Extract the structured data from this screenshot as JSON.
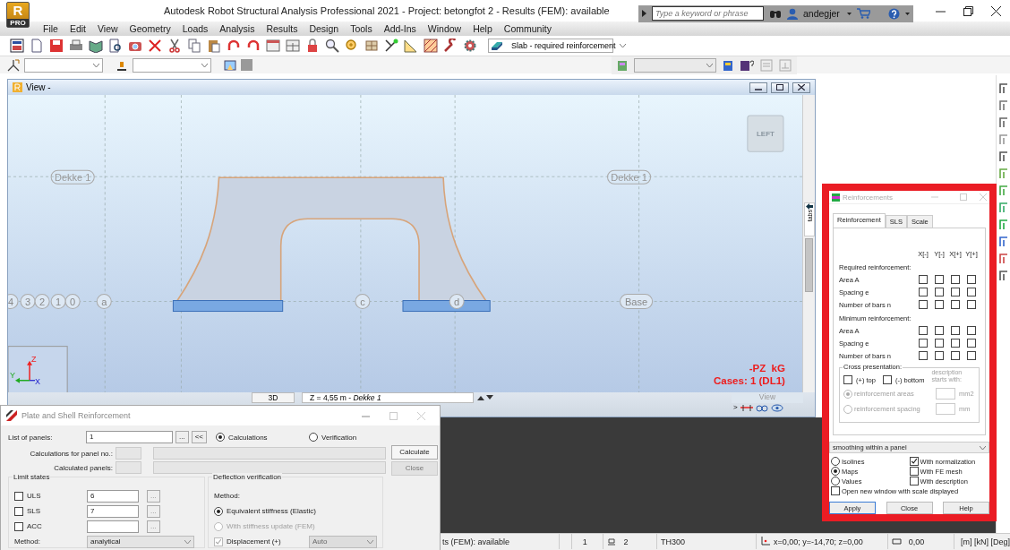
{
  "window": {
    "logo_letter": "R",
    "logo_edition": "PRO",
    "title": "Autodesk Robot Structural Analysis Professional 2021 - Project: betongfot 2 - Results (FEM): available"
  },
  "search": {
    "placeholder": "Type a keyword or phrase"
  },
  "user": "andegjer",
  "menu": [
    "File",
    "Edit",
    "View",
    "Geometry",
    "Loads",
    "Analysis",
    "Results",
    "Design",
    "Tools",
    "Add-Ins",
    "Window",
    "Help",
    "Community"
  ],
  "toolbar": {
    "result_view": "Slab - required reinforcement"
  },
  "view": {
    "title": "View -",
    "cube_label": "LEFT",
    "level_labels": [
      "Dekke 1",
      "Dekke 1"
    ],
    "axis_labels": [
      "4",
      "3",
      "2",
      "1",
      "0",
      "a",
      "c",
      "d",
      "Base"
    ],
    "triad_labels": [
      "Z",
      "Y",
      "X"
    ],
    "result_label": "-PZ  kG",
    "cases": "Cases: 1 (DL1)",
    "mode_button": "3D",
    "level_field": "Z = 4,55 m - *Dekke 1*",
    "view_tab": "View",
    "side_tab": "tabs",
    "nav_arrow": ">"
  },
  "reinforcements": {
    "title": "Reinforcements",
    "tabs": [
      {
        "label": "Reinforcement",
        "selected": true
      },
      {
        "label": "SLS",
        "selected": false
      },
      {
        "label": "Scale",
        "selected": false
      }
    ],
    "columns": [
      "X[-]",
      "Y[-]",
      "X[+]",
      "Y[+]"
    ],
    "sections": [
      {
        "heading": "Required reinforcement:",
        "rows": [
          {
            "label": "Area A",
            "checks": [
              false,
              false,
              false,
              false
            ]
          },
          {
            "label": "Spacing e",
            "checks": [
              false,
              false,
              false,
              false
            ]
          },
          {
            "label": "Number of bars n",
            "checks": [
              false,
              false,
              false,
              false
            ]
          }
        ]
      },
      {
        "heading": "Minimum reinforcement:",
        "rows": [
          {
            "label": "Area A",
            "checks": [
              false,
              false,
              false,
              false
            ]
          },
          {
            "label": "Spacing e",
            "checks": [
              false,
              false,
              false,
              false
            ]
          },
          {
            "label": "Number of bars n",
            "checks": [
              false,
              false,
              false,
              false
            ]
          }
        ]
      }
    ],
    "cross": {
      "title": "Cross presentation:",
      "faces": [
        {
          "label": "(+) top",
          "checked": false
        },
        {
          "label": "(-) bottom",
          "checked": false
        }
      ],
      "description": "description starts with:",
      "options": [
        {
          "label": "reinforcement areas",
          "selected": true,
          "disabled": true,
          "unit": "mm2"
        },
        {
          "label": "reinforcement spacing",
          "selected": false,
          "disabled": true,
          "unit": "mm"
        }
      ]
    },
    "smoothing": "smoothing within a panel",
    "modes": [
      {
        "label": "Isolines",
        "selected": false
      },
      {
        "label": "Maps",
        "selected": true
      },
      {
        "label": "Values",
        "selected": false
      }
    ],
    "options": [
      {
        "label": "With normalization",
        "checked": true
      },
      {
        "label": "With FE mesh",
        "checked": false
      },
      {
        "label": "With description",
        "checked": false
      }
    ],
    "open_new": {
      "label": "Open new window with scale displayed",
      "checked": false
    },
    "buttons": [
      "Apply",
      "Close",
      "Help"
    ]
  },
  "plate": {
    "title": "Plate and Shell Reinforcement",
    "list_label": "List of panels:",
    "list_value": "1",
    "browse": "...",
    "collapse": "<<",
    "modes": [
      {
        "label": "Calculations",
        "selected": true
      },
      {
        "label": "Verification",
        "selected": false
      }
    ],
    "panel_no_label": "Calculations for panel no.:",
    "calculated_label": "Calculated panels:",
    "buttons": [
      {
        "label": "Calculate",
        "disabled": false
      },
      {
        "label": "Close",
        "disabled": true
      }
    ],
    "limit_title": "Limit states",
    "limits": [
      {
        "label": "ULS",
        "checked": false,
        "value": "6"
      },
      {
        "label": "SLS",
        "checked": false,
        "value": "7"
      },
      {
        "label": "ACC",
        "checked": false
      }
    ],
    "method_label": "Method:",
    "method": "analytical",
    "deflection_title": "Deflection verification",
    "deflection_method_label": "Method:",
    "deflection_methods": [
      {
        "label": "Equivalent stiffness (Elastic)",
        "selected": true,
        "disabled": false
      },
      {
        "label": "With stiffness update (FEM)",
        "selected": false,
        "disabled": true
      }
    ],
    "displacement": {
      "label": "Displacement (+)",
      "checked": true,
      "disabled": true
    },
    "displacement_mode": "Auto"
  },
  "status_bar": {
    "message": "ts (FEM): available",
    "case": "1",
    "panel": "2",
    "thickness": "TH300",
    "coordinates": "x=0,00; y=-14,70; z=0,00",
    "angle": "0,00",
    "units": "[m] [kN] [Deg]"
  }
}
